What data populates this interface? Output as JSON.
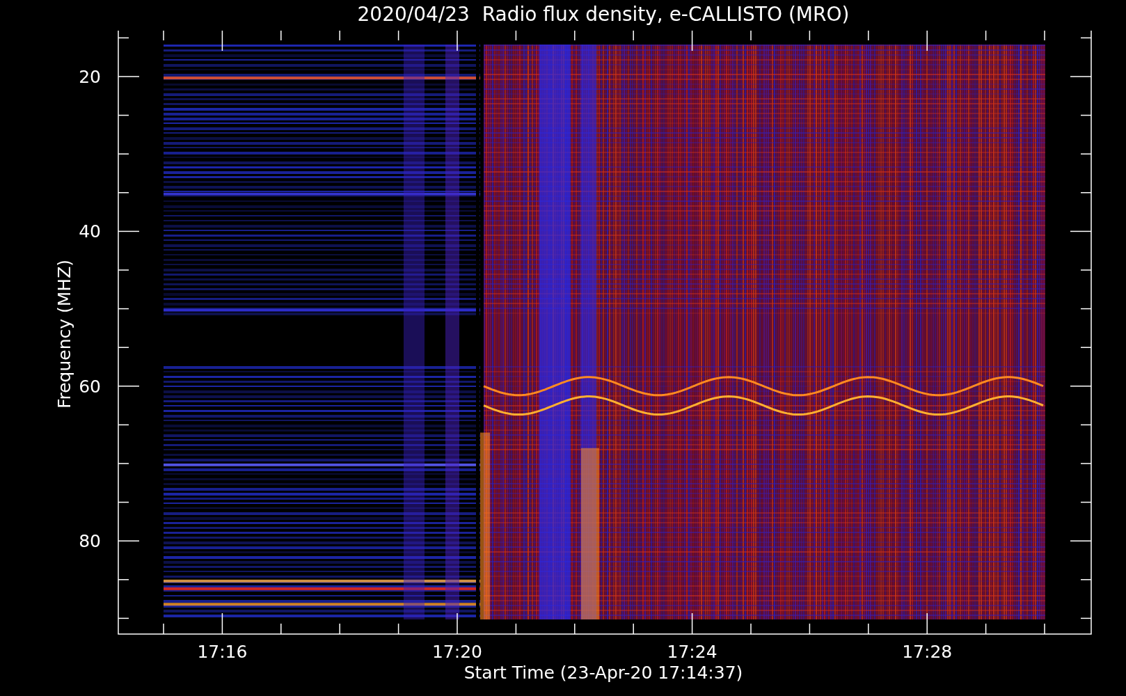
{
  "title": "2020/04/23  Radio flux density, e-CALLISTO (MRO)",
  "plot": {
    "ylabel": "Frequency (MHZ)",
    "xlabel": "Start Time (23-Apr-20 17:14:37)",
    "yticks": [
      "20",
      "40",
      "60",
      "80"
    ],
    "xticks": [
      "17:16",
      "17:20",
      "17:24",
      "17:28"
    ]
  }
}
